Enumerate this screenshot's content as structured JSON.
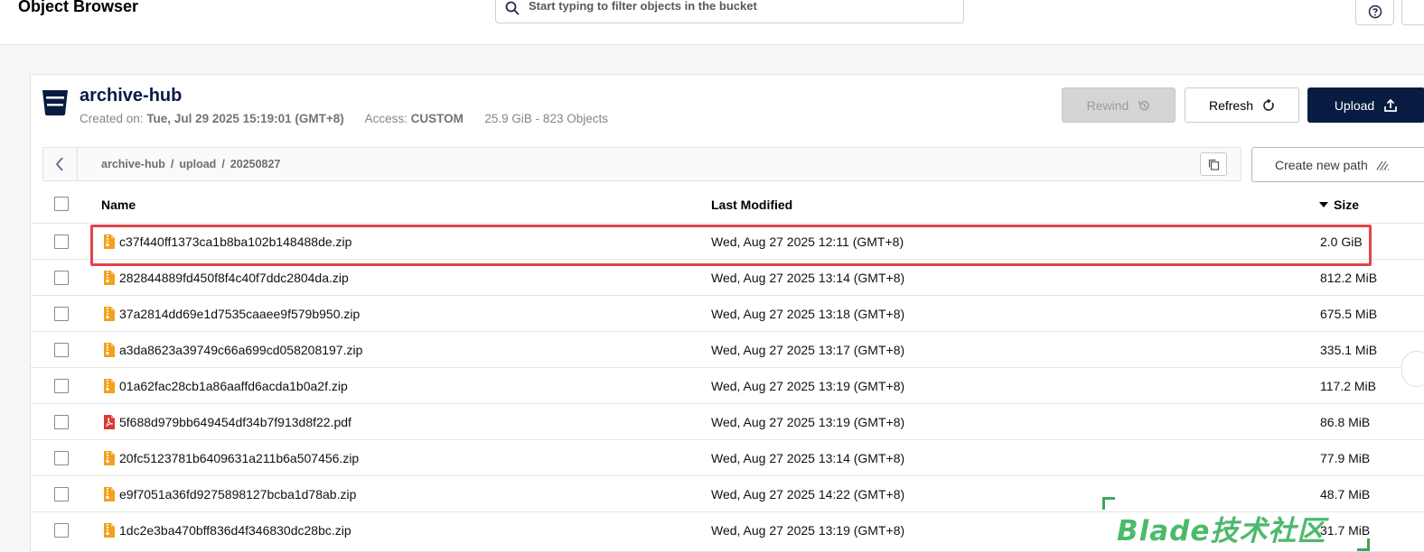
{
  "header": {
    "title": "Object Browser",
    "search_placeholder": "Start typing to filter objects in the bucket"
  },
  "bucket": {
    "name": "archive-hub",
    "created_label": "Created on:",
    "created_value": "Tue, Jul 29 2025 15:19:01 (GMT+8)",
    "access_label": "Access:",
    "access_value": "CUSTOM",
    "usage": "25.9 GiB - 823 Objects"
  },
  "actions": {
    "rewind": "Rewind",
    "refresh": "Refresh",
    "upload": "Upload",
    "create_path": "Create new path"
  },
  "breadcrumb": [
    "archive-hub",
    "upload",
    "20250827"
  ],
  "table": {
    "columns": {
      "name": "Name",
      "modified": "Last Modified",
      "size": "Size"
    },
    "sort": {
      "column": "size",
      "direction": "desc"
    },
    "rows": [
      {
        "name": "c37f440ff1373ca1b8ba102b148488de.zip",
        "modified": "Wed, Aug 27 2025 12:11 (GMT+8)",
        "size": "2.0 GiB",
        "type": "zip",
        "highlighted": true
      },
      {
        "name": "282844889fd450f8f4c40f7ddc2804da.zip",
        "modified": "Wed, Aug 27 2025 13:14 (GMT+8)",
        "size": "812.2 MiB",
        "type": "zip"
      },
      {
        "name": "37a2814dd69e1d7535caaee9f579b950.zip",
        "modified": "Wed, Aug 27 2025 13:18 (GMT+8)",
        "size": "675.5 MiB",
        "type": "zip"
      },
      {
        "name": "a3da8623a39749c66a699cd058208197.zip",
        "modified": "Wed, Aug 27 2025 13:17 (GMT+8)",
        "size": "335.1 MiB",
        "type": "zip"
      },
      {
        "name": "01a62fac28cb1a86aaffd6acda1b0a2f.zip",
        "modified": "Wed, Aug 27 2025 13:19 (GMT+8)",
        "size": "117.2 MiB",
        "type": "zip"
      },
      {
        "name": "5f688d979bb649454df34b7f913d8f22.pdf",
        "modified": "Wed, Aug 27 2025 13:19 (GMT+8)",
        "size": "86.8 MiB",
        "type": "pdf"
      },
      {
        "name": "20fc5123781b6409631a211b6a507456.zip",
        "modified": "Wed, Aug 27 2025 13:14 (GMT+8)",
        "size": "77.9 MiB",
        "type": "zip"
      },
      {
        "name": "e9f7051a36fd9275898127bcba1d78ab.zip",
        "modified": "Wed, Aug 27 2025 14:22 (GMT+8)",
        "size": "48.7 MiB",
        "type": "zip"
      },
      {
        "name": "1dc2e3ba470bff836d4f346830dc28bc.zip",
        "modified": "Wed, Aug 27 2025 13:19 (GMT+8)",
        "size": "31.7 MiB",
        "type": "zip"
      }
    ]
  },
  "watermark": {
    "text": "Blade技术社区"
  },
  "colors": {
    "primary": "#081c42",
    "highlight": "#e0444c",
    "zip_icon": "#f2a11f",
    "pdf_icon": "#d93a33",
    "watermark": "#4cba6a"
  },
  "icons": {
    "search": "search-icon",
    "help": "help-icon",
    "bucket": "bucket-icon",
    "rewind": "rewind-icon",
    "refresh": "refresh-icon",
    "upload": "upload-icon",
    "back": "chevron-left-icon",
    "copy": "copy-icon",
    "new_path": "new-path-icon",
    "sort": "sort-desc-icon",
    "zip": "zip-file-icon",
    "pdf": "pdf-file-icon"
  }
}
